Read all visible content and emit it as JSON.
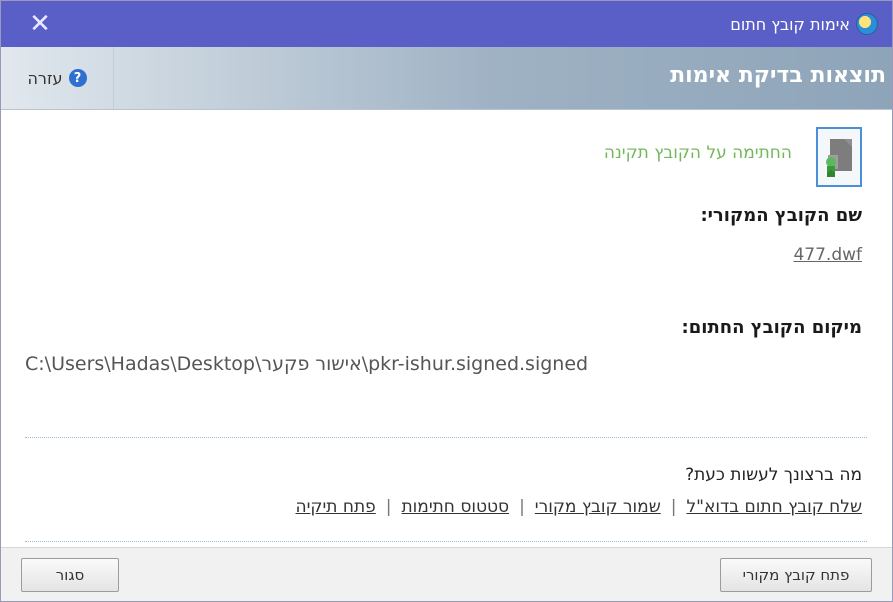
{
  "window": {
    "title": "אימות קובץ חתום",
    "close_glyph": "✕"
  },
  "header": {
    "title": "תוצאות בדיקת אימות",
    "help_label": "עזרה",
    "help_glyph": "?"
  },
  "result": {
    "status": "החתימה על הקובץ תקינה",
    "original_label": "שם הקובץ המקורי:",
    "original_file": "477.dwf",
    "location_label": "מיקום הקובץ החתום:",
    "location_path": "C:\\Users\\Hadas\\Desktop\\אישור פקער\\pkr-ishur.signed.signed"
  },
  "actions": {
    "question": "מה ברצונך לעשות כעת?",
    "links": [
      "פתח תיקיה",
      "סטטוס חתימות",
      "שמור קובץ מקורי",
      "שלח קובץ חתום בדוא\"ל"
    ],
    "separator": "|"
  },
  "footer": {
    "open_button": "פתח קובץ מקורי",
    "close_button": "סגור"
  },
  "colors": {
    "titlebar": "#5a5fc7",
    "status_text": "#72b85a",
    "header_title": "#ffffff"
  },
  "icons": [
    "close-icon",
    "app-icon",
    "help-icon",
    "signed-file-icon"
  ]
}
